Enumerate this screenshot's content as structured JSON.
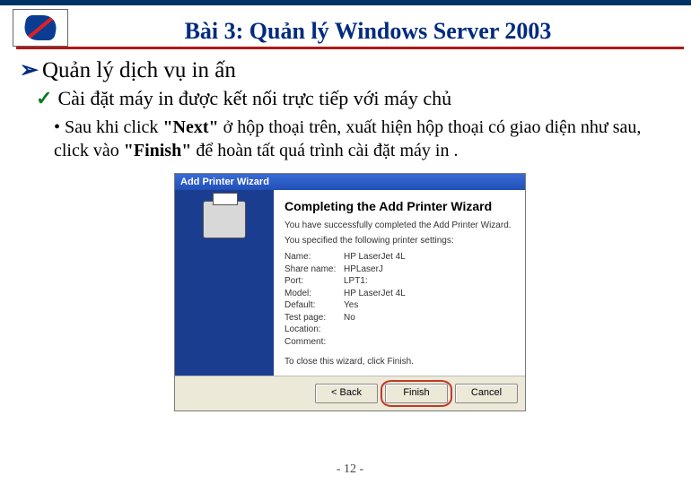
{
  "header": {
    "title": "Bài 3: Quản lý Windows Server 2003"
  },
  "section": {
    "heading": "Quản lý dịch vụ in ấn",
    "sub": "Cài đặt máy in được kết nối trực tiếp với máy chủ",
    "body_prefix": "• Sau khi click ",
    "body_q1": "\"Next\"",
    "body_mid": " ở hộp thoại trên, xuất hiện hộp thoại có giao diện như sau, click vào ",
    "body_q2": "\"Finish\"",
    "body_suffix": " để hoàn tất quá trình cài đặt máy in ."
  },
  "dialog": {
    "title": "Add Printer Wizard",
    "heading": "Completing the Add Printer Wizard",
    "line1": "You have successfully completed the Add Printer Wizard.",
    "line2": "You specified the following printer settings:",
    "rows": {
      "name_k": "Name:",
      "name_v": "HP LaserJet 4L",
      "share_k": "Share name:",
      "share_v": "HPLaserJ",
      "port_k": "Port:",
      "port_v": "LPT1:",
      "model_k": "Model:",
      "model_v": "HP LaserJet 4L",
      "default_k": "Default:",
      "default_v": "Yes",
      "test_k": "Test page:",
      "test_v": "No",
      "loc_k": "Location:",
      "loc_v": "",
      "comm_k": "Comment:",
      "comm_v": ""
    },
    "close_text": "To close this wizard, click Finish.",
    "buttons": {
      "back": "< Back",
      "finish": "Finish",
      "cancel": "Cancel"
    }
  },
  "footer": {
    "page": "- 12 -"
  }
}
